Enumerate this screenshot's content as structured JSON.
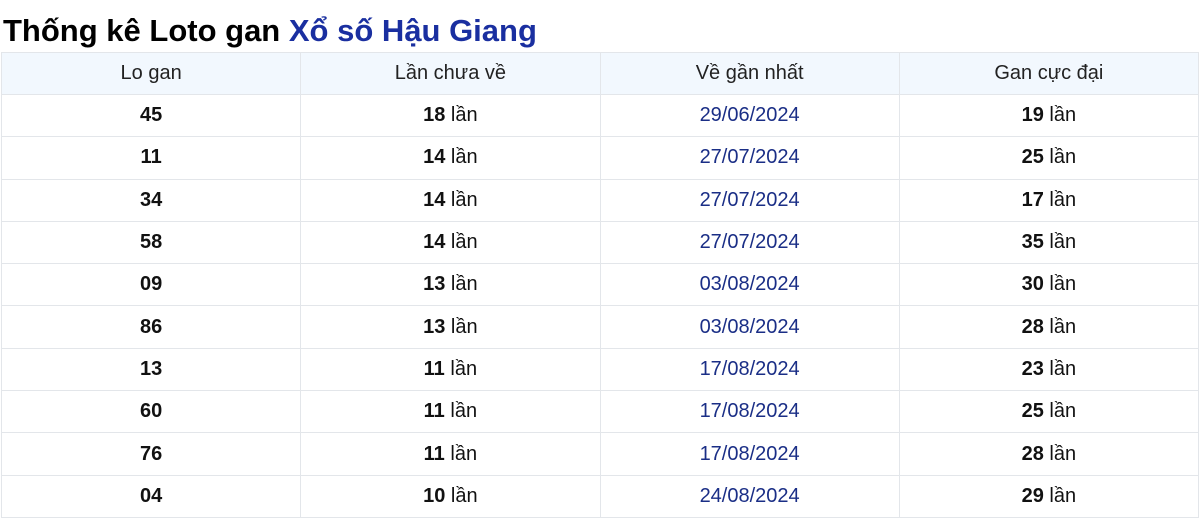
{
  "title": {
    "prefix": "Thống kê Loto gan",
    "place": "Xổ số Hậu Giang"
  },
  "table": {
    "headers": [
      "Lo gan",
      "Lần chưa về",
      "Về gần nhất",
      "Gan cực đại"
    ],
    "unit": "lần",
    "rows": [
      {
        "number": "45",
        "absent": "18",
        "last_date": "29/06/2024",
        "max": "19"
      },
      {
        "number": "11",
        "absent": "14",
        "last_date": "27/07/2024",
        "max": "25"
      },
      {
        "number": "34",
        "absent": "14",
        "last_date": "27/07/2024",
        "max": "17"
      },
      {
        "number": "58",
        "absent": "14",
        "last_date": "27/07/2024",
        "max": "35"
      },
      {
        "number": "09",
        "absent": "13",
        "last_date": "03/08/2024",
        "max": "30"
      },
      {
        "number": "86",
        "absent": "13",
        "last_date": "03/08/2024",
        "max": "28"
      },
      {
        "number": "13",
        "absent": "11",
        "last_date": "17/08/2024",
        "max": "23"
      },
      {
        "number": "60",
        "absent": "11",
        "last_date": "17/08/2024",
        "max": "25"
      },
      {
        "number": "76",
        "absent": "11",
        "last_date": "17/08/2024",
        "max": "28"
      },
      {
        "number": "04",
        "absent": "10",
        "last_date": "24/08/2024",
        "max": "29"
      }
    ]
  },
  "colors": {
    "title_accent": "#1a2fa0",
    "date_text": "#1a2e86",
    "header_bg": "#f2f8fe",
    "border": "#e3e6ea"
  }
}
